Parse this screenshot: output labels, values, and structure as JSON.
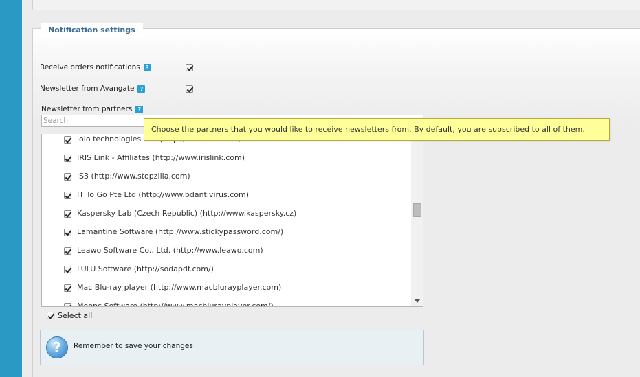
{
  "notification_settings": {
    "legend": "Notification settings",
    "orders_label": "Receive orders notifications",
    "orders_help": "?",
    "avangate_label": "Newsletter from Avangate",
    "avangate_help": "?",
    "partners_label": "Newsletter from partners",
    "partners_help": "?",
    "search_placeholder": "Search",
    "partners": [
      {
        "label": "iolo technologies LLC (http://www.iolo.com)",
        "checked": true
      },
      {
        "label": "IRIS Link - Affiliates (http://www.irislink.com)",
        "checked": true
      },
      {
        "label": "iS3 (http://www.stopzilla.com)",
        "checked": true
      },
      {
        "label": "IT To Go Pte Ltd (http://www.bdantivirus.com)",
        "checked": true
      },
      {
        "label": "Kaspersky Lab (Czech Republic) (http://www.kaspersky.cz)",
        "checked": true
      },
      {
        "label": "Lamantine Software (http://www.stickypassword.com/)",
        "checked": true
      },
      {
        "label": "Leawo Software Co., Ltd. (http://www.leawo.com)",
        "checked": true
      },
      {
        "label": "LULU Software (http://sodapdf.com/)",
        "checked": true
      },
      {
        "label": "Mac Blu-ray player (http://www.macblurayplayer.com)",
        "checked": true
      },
      {
        "label": "Moonc Software (http://www.macblurayplayer.com/)",
        "checked": true
      }
    ],
    "select_all_label": "Select all",
    "save_reminder": "Remember to save your changes",
    "info_icon": "question-icon",
    "tooltip": "Choose the partners that you would like to receive newsletters from. By default, you are subscribed to all of them."
  },
  "colors": {
    "sidebar": "#2a9ac4",
    "legend_text": "#3e6d96",
    "tooltip_bg": "#ffff99",
    "help_icon": "#2aa0d4"
  }
}
